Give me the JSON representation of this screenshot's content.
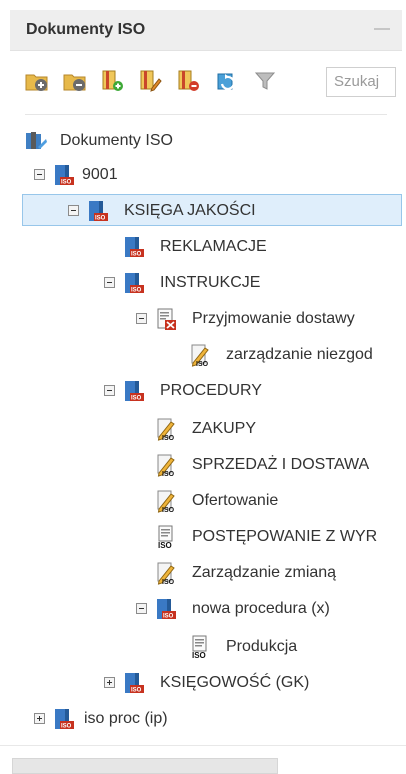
{
  "panel": {
    "title": "Dokumenty ISO"
  },
  "toolbar": {
    "buttons": [
      "add-folder-icon",
      "remove-folder-icon",
      "add-document-icon",
      "edit-document-icon",
      "delete-document-icon",
      "refresh-icon",
      "filter-icon"
    ],
    "search_placeholder": "Szukaj"
  },
  "tree": {
    "root": "Dokumenty ISO",
    "n_9001": "9001",
    "n_ksiega": "KSIĘGA JAKOŚCI",
    "n_reklamacje": "REKLAMACJE",
    "n_instrukcje": "INSTRUKCJE",
    "n_przyjmowanie": "Przyjmowanie dostawy",
    "n_zarzadzanie_niezgod": "zarządzanie niezgod",
    "n_procedury": "PROCEDURY",
    "n_zakupy": "ZAKUPY",
    "n_sprzedaz": "SPRZEDAŻ I DOSTAWA",
    "n_ofertowanie": "Ofertowanie",
    "n_postepowanie": "POSTĘPOWANIE Z WYR",
    "n_zarzadzanie_zmiana": "Zarządzanie zmianą",
    "n_nowa_procedura": "nowa procedura (x)",
    "n_produkcja": "Produkcja",
    "n_ksiegowosc": "KSIĘGOWOŚĆ (GK)",
    "n_iso_proc": "iso proc (ip)"
  }
}
